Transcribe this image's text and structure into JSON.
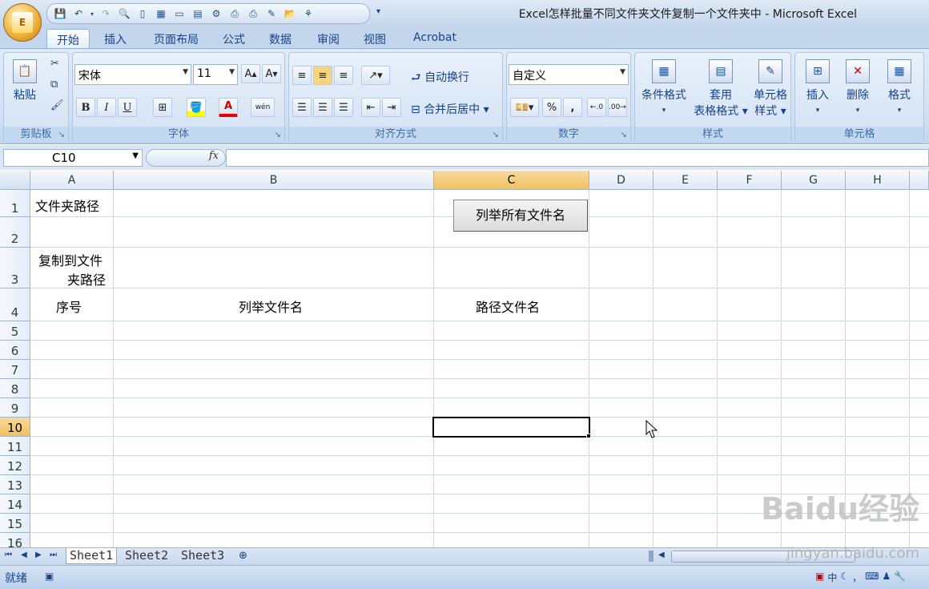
{
  "app": {
    "title": "Excel怎样批量不同文件夹文件复制一个文件夹中 - Microsoft Excel",
    "office_button_logo": "E"
  },
  "qat": {
    "icons": [
      "save-icon",
      "undo-icon",
      "dropdown-arrow-icon",
      "redo-icon",
      "print-preview-icon",
      "new-document-icon",
      "table-icon",
      "comment-icon",
      "form-icon",
      "zoom-icon",
      "printer-icon",
      "print-icon",
      "edit-icon",
      "open-folder-icon",
      "tree-icon",
      "customize-qat-icon"
    ]
  },
  "tabs": [
    "开始",
    "插入",
    "页面布局",
    "公式",
    "数据",
    "审阅",
    "视图",
    "Acrobat"
  ],
  "ribbon": {
    "clipboard": {
      "label": "剪贴板",
      "paste": "粘贴"
    },
    "font": {
      "label": "字体",
      "name": "宋体",
      "size": "11",
      "bold": "B",
      "italic": "I",
      "underline": "U",
      "font_color": "A",
      "phonetic": "wén"
    },
    "alignment": {
      "label": "对齐方式",
      "wrap": "自动换行",
      "merge": "合并后居中"
    },
    "number": {
      "label": "数字",
      "format": "自定义",
      "percent": "%",
      "comma": ","
    },
    "styles": {
      "label": "样式",
      "conditional": "条件格式",
      "table_fmt_1": "套用",
      "table_fmt_2": "表格格式",
      "cell_style_1": "单元格",
      "cell_style_2": "样式"
    },
    "cells": {
      "label": "单元格",
      "insert": "插入",
      "delete": "删除",
      "format": "格式"
    }
  },
  "formula_bar": {
    "name_box": "C10",
    "fx": "fx",
    "value": ""
  },
  "columns": [
    "A",
    "B",
    "C",
    "D",
    "E",
    "F",
    "G",
    "H"
  ],
  "rows": [
    "1",
    "2",
    "3",
    "4",
    "5",
    "6",
    "7",
    "8",
    "9",
    "10",
    "11",
    "12",
    "13",
    "14",
    "15",
    "16"
  ],
  "cells": {
    "A1": "文件夹路径",
    "A3_line1": "复制到文件",
    "A3_line2": "夹路径",
    "A4": "序号",
    "B4": "列举文件名",
    "C4": "路径文件名"
  },
  "macro_button": "列举所有文件名",
  "sheets": [
    "Sheet1",
    "Sheet2",
    "Sheet3"
  ],
  "active_sheet": "Sheet1",
  "status": {
    "text": "就绪"
  },
  "ime": [
    "中",
    "，",
    "⌨"
  ],
  "watermark": {
    "main": "Baidu经验",
    "sub": "jingyan.baidu.com"
  }
}
